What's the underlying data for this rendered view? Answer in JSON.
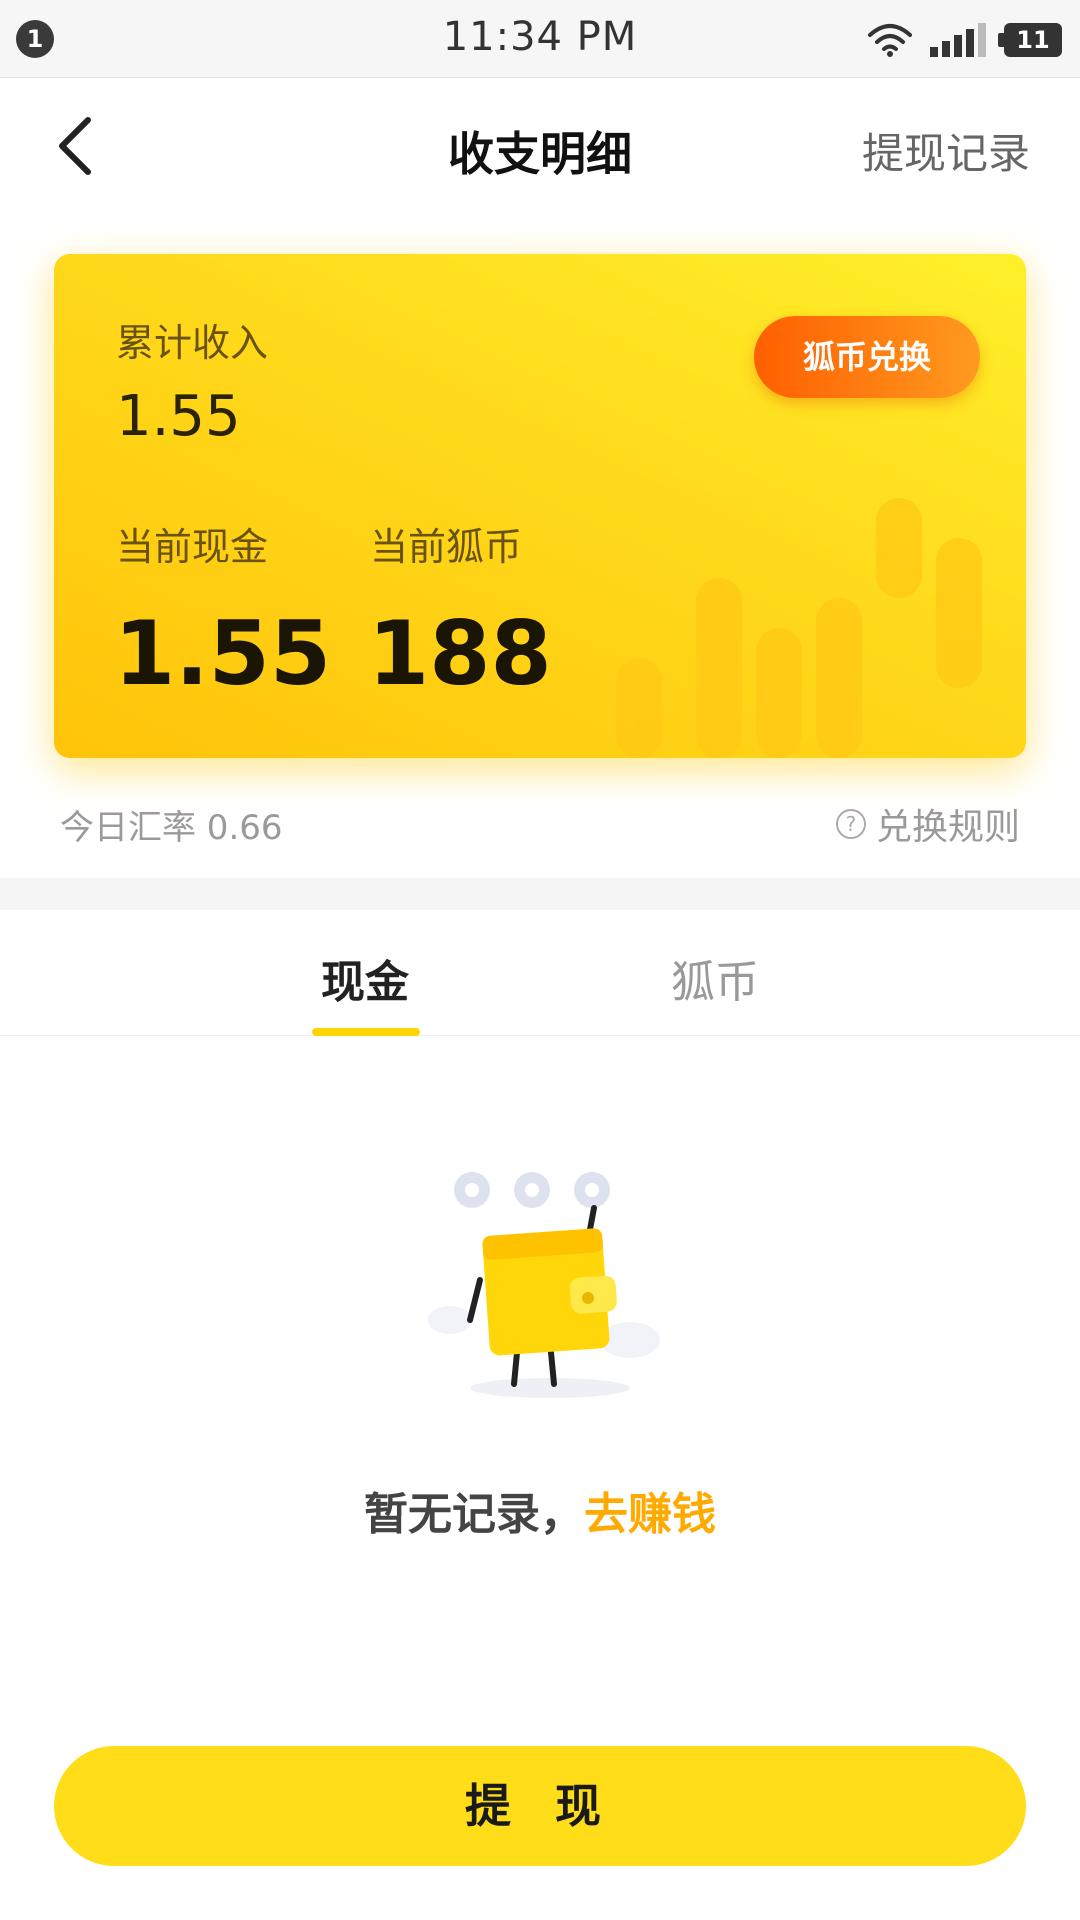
{
  "status_bar": {
    "notification_count": "1",
    "time": "11:34 PM",
    "battery": "11",
    "icons": [
      "wifi-icon",
      "signal-icon",
      "battery-icon"
    ]
  },
  "nav": {
    "title": "收支明细",
    "right_action": "提现记录",
    "back_icon": "chevron-left-icon"
  },
  "summary_card": {
    "total_income_label": "累计收入",
    "total_income_value": "1.55",
    "current_cash_label": "当前现金",
    "current_cash_value": "1.55",
    "current_coins_label": "当前狐币",
    "current_coins_value": "188",
    "exchange_button": "狐币兑换"
  },
  "rate": {
    "text": "今日汇率 0.66",
    "rules_label": "兑换规则",
    "rules_icon": "question-circle-icon"
  },
  "tabs": [
    {
      "label": "现金",
      "active": true
    },
    {
      "label": "狐币",
      "active": false
    }
  ],
  "empty_state": {
    "text": "暂无记录，",
    "link": "去赚钱",
    "illustration": "wallet-character-illustration"
  },
  "withdraw_button": "提 现",
  "colors": {
    "accent_yellow": "#ffdd18",
    "orange": "#ff6a00",
    "link_orange": "#ffaa00"
  }
}
